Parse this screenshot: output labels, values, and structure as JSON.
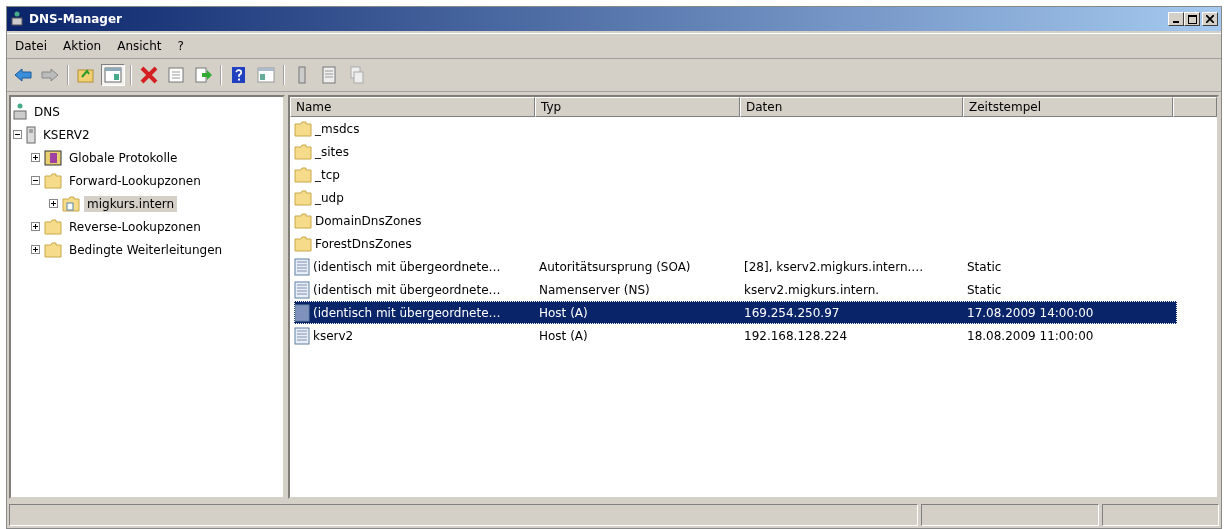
{
  "window": {
    "title": "DNS-Manager"
  },
  "menu": [
    {
      "label": "Datei"
    },
    {
      "label": "Aktion"
    },
    {
      "label": "Ansicht"
    },
    {
      "label": "?"
    }
  ],
  "toolbar": [
    {
      "kind": "back",
      "pressed": false
    },
    {
      "kind": "forward",
      "pressed": false
    },
    {
      "kind": "sep"
    },
    {
      "kind": "up",
      "pressed": false
    },
    {
      "kind": "tree",
      "pressed": true
    },
    {
      "kind": "sep"
    },
    {
      "kind": "delete",
      "pressed": false
    },
    {
      "kind": "properties",
      "pressed": false
    },
    {
      "kind": "export",
      "pressed": false
    },
    {
      "kind": "sep"
    },
    {
      "kind": "help",
      "pressed": false
    },
    {
      "kind": "panel",
      "pressed": false
    },
    {
      "kind": "sep"
    },
    {
      "kind": "server",
      "pressed": false
    },
    {
      "kind": "doc",
      "pressed": false
    },
    {
      "kind": "copy",
      "pressed": false
    }
  ],
  "tree": [
    {
      "label": "DNS",
      "kind": "dns",
      "selected": false,
      "children": [
        {
          "label": "KSERV2",
          "kind": "server",
          "expanded": true,
          "selected": false,
          "children": [
            {
              "label": "Globale Protokolle",
              "kind": "log",
              "expanded": false,
              "selected": false
            },
            {
              "label": "Forward-Lookupzonen",
              "kind": "folder",
              "expanded": true,
              "selected": false,
              "children": [
                {
                  "label": "migkurs.intern",
                  "kind": "zone",
                  "expanded": false,
                  "selected": true
                }
              ]
            },
            {
              "label": "Reverse-Lookupzonen",
              "kind": "folder",
              "expanded": false,
              "selected": false
            },
            {
              "label": "Bedingte Weiterleitungen",
              "kind": "folder",
              "expanded": false,
              "selected": false
            }
          ]
        }
      ]
    }
  ],
  "table": {
    "columns": [
      "Name",
      "Typ",
      "Daten",
      "Zeitstempel"
    ],
    "rows": [
      {
        "kind": "folder",
        "selected": false,
        "cells": [
          "_msdcs",
          "",
          "",
          ""
        ]
      },
      {
        "kind": "folder",
        "selected": false,
        "cells": [
          "_sites",
          "",
          "",
          ""
        ]
      },
      {
        "kind": "folder",
        "selected": false,
        "cells": [
          "_tcp",
          "",
          "",
          ""
        ]
      },
      {
        "kind": "folder",
        "selected": false,
        "cells": [
          "_udp",
          "",
          "",
          ""
        ]
      },
      {
        "kind": "folder",
        "selected": false,
        "cells": [
          "DomainDnsZones",
          "",
          "",
          ""
        ]
      },
      {
        "kind": "folder",
        "selected": false,
        "cells": [
          "ForestDnsZones",
          "",
          "",
          ""
        ]
      },
      {
        "kind": "record",
        "selected": false,
        "cells": [
          "(identisch mit übergeordnete…",
          "Autoritätsursprung (SOA)",
          "[28], kserv2.migkurs.intern.…",
          "Static"
        ]
      },
      {
        "kind": "record",
        "selected": false,
        "cells": [
          "(identisch mit übergeordnete…",
          "Namenserver (NS)",
          "kserv2.migkurs.intern.",
          "Static"
        ]
      },
      {
        "kind": "record",
        "selected": true,
        "cells": [
          "(identisch mit übergeordnete…",
          "Host (A)",
          "169.254.250.97",
          "17.08.2009 14:00:00"
        ]
      },
      {
        "kind": "record",
        "selected": false,
        "cells": [
          "kserv2",
          "Host (A)",
          "192.168.128.224",
          "18.08.2009 11:00:00"
        ]
      }
    ]
  }
}
